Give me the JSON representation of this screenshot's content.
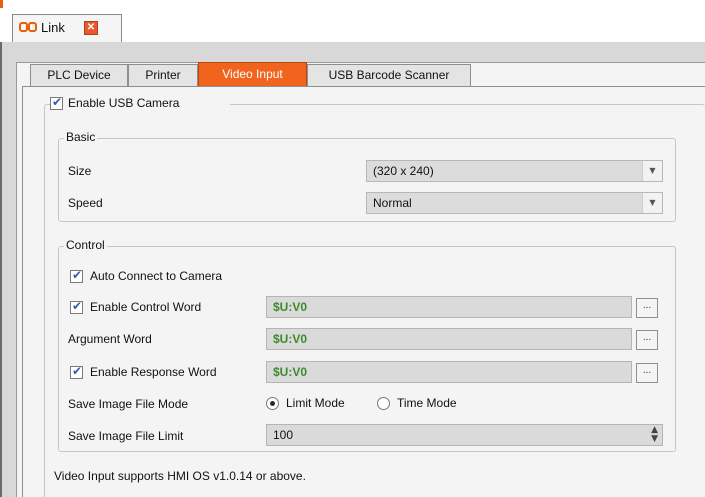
{
  "document_tab": {
    "title": "Link",
    "close_glyph": "✕"
  },
  "tabs": [
    {
      "label": "PLC Device",
      "active": false
    },
    {
      "label": "Printer",
      "active": false
    },
    {
      "label": "Video Input",
      "active": true
    },
    {
      "label": "USB Barcode Scanner",
      "active": false
    }
  ],
  "enable_usb_camera": {
    "label": "Enable USB Camera",
    "checked": true
  },
  "basic": {
    "legend": "Basic",
    "size": {
      "label": "Size",
      "value": "(320 x 240)"
    },
    "speed": {
      "label": "Speed",
      "value": "Normal"
    }
  },
  "control": {
    "legend": "Control",
    "auto_connect": {
      "label": "Auto Connect to Camera",
      "checked": true
    },
    "enable_control_word": {
      "label": "Enable Control Word",
      "checked": true,
      "value": "$U:V0"
    },
    "argument_word": {
      "label": "Argument Word",
      "value": "$U:V0"
    },
    "enable_response_word": {
      "label": "Enable Response Word",
      "checked": true,
      "value": "$U:V0"
    },
    "save_mode": {
      "label": "Save Image File Mode",
      "options": [
        "Limit Mode",
        "Time Mode"
      ],
      "selected": "Limit Mode"
    },
    "save_limit": {
      "label": "Save Image File Limit",
      "value": "100"
    }
  },
  "browse_label": "...",
  "footer_note": "Video Input supports HMI OS v1.0.14 or above.",
  "colors": {
    "active_tab": "#f0641e",
    "tag_value": "#3d8a2a",
    "brand": "#e8600a"
  },
  "icons": {
    "checkbox": "check-icon",
    "dropdown": "chevron-down-icon",
    "spin": "spin-arrows-icon"
  }
}
